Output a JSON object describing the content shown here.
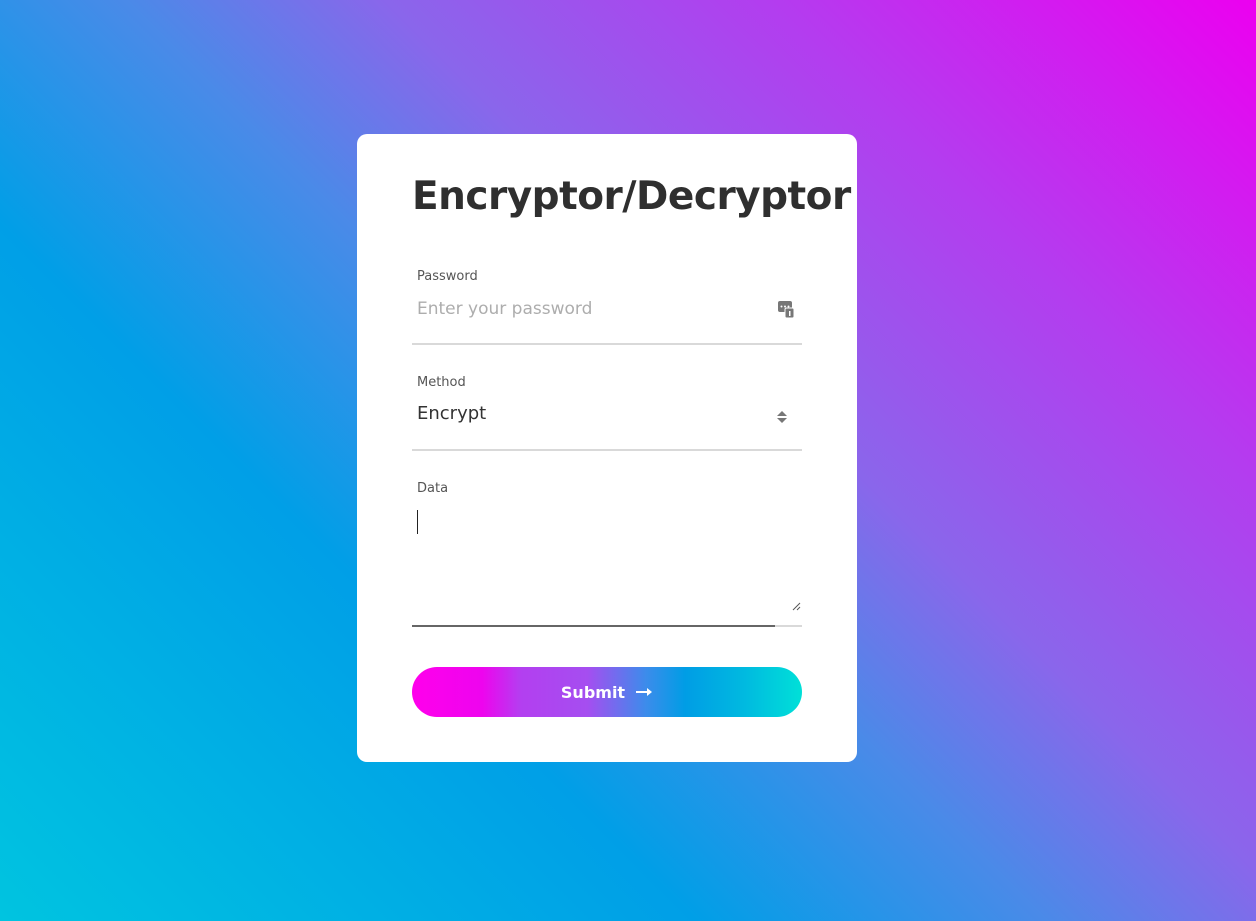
{
  "form": {
    "title": "Encryptor/Decryptor",
    "password": {
      "label": "Password",
      "placeholder": "Enter your password",
      "value": "",
      "icon": "password-manager-icon"
    },
    "method": {
      "label": "Method",
      "selected": "Encrypt",
      "icon": "select-arrows-icon"
    },
    "data": {
      "label": "Data",
      "value": ""
    },
    "submit": {
      "label": "Submit",
      "icon": "arrow-right-icon"
    }
  },
  "colors": {
    "background_gradient": [
      "#ec00f0",
      "#b43cef",
      "#4a8ae8",
      "#009fe7",
      "#00c4e0"
    ],
    "button_gradient": [
      "#ff00ec",
      "#b33ff0",
      "#009de5",
      "#00e0d8"
    ],
    "title": "#2f2f2f"
  }
}
